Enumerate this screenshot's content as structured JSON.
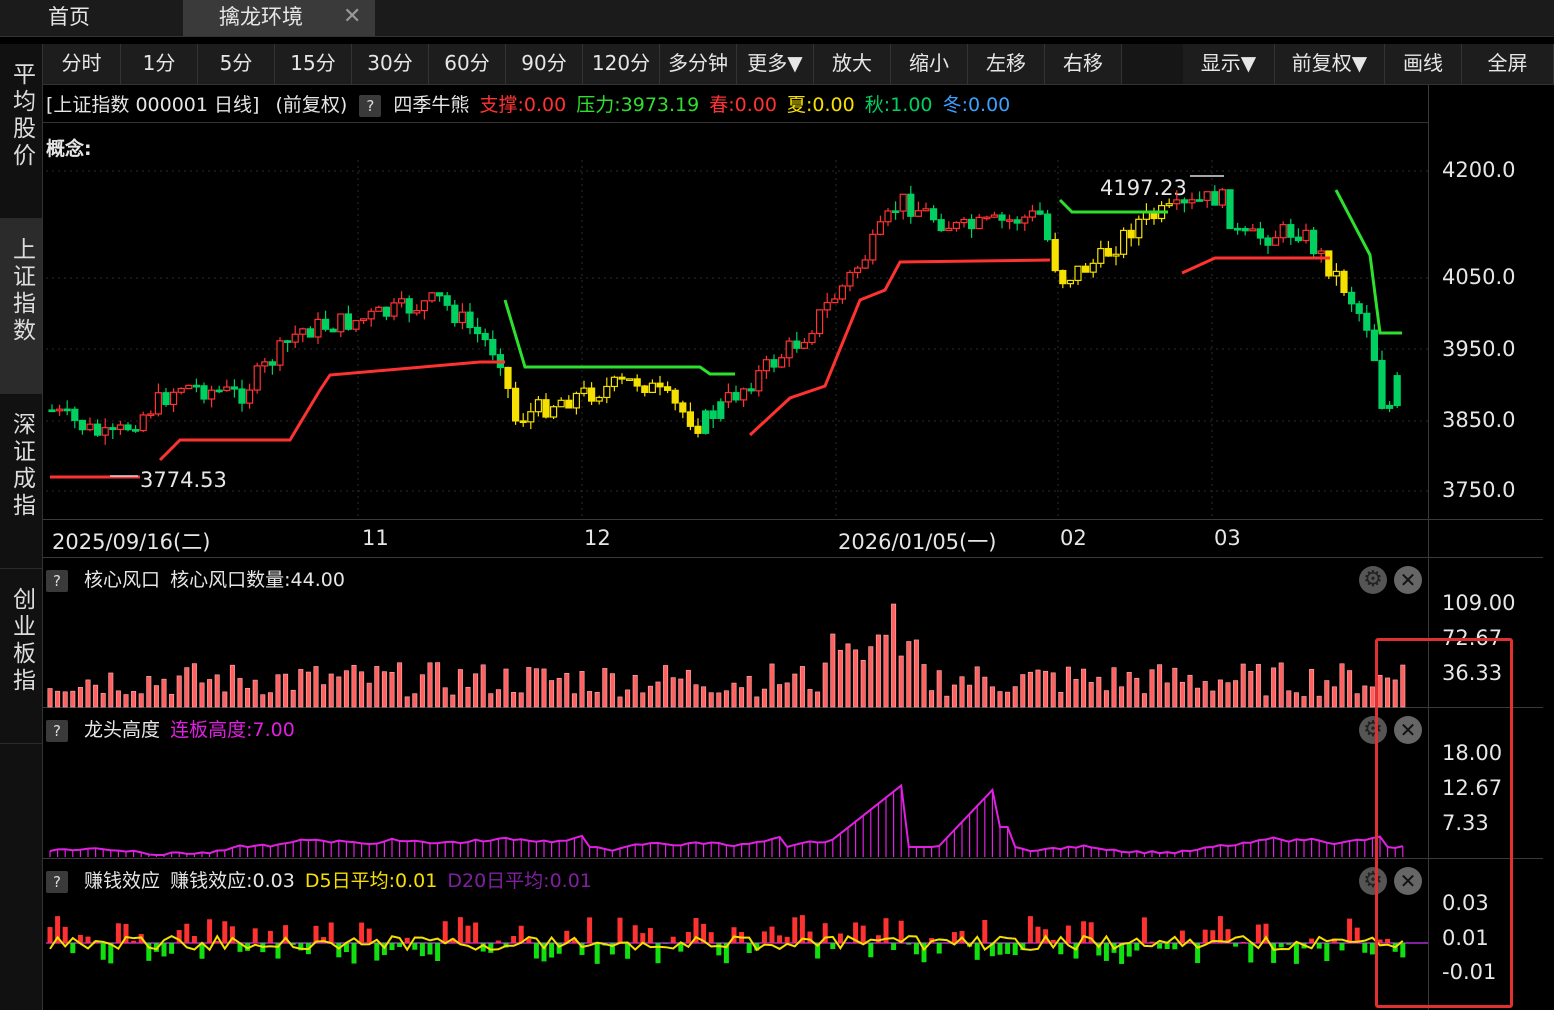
{
  "tabs": {
    "home": "首页",
    "active": "擒龙环境",
    "close_symbol": "✕"
  },
  "left_nav": [
    {
      "label": "平均股价"
    },
    {
      "label": "上证指数"
    },
    {
      "label": "深证成指"
    },
    {
      "label": "创业板指"
    }
  ],
  "toolbar": [
    "分时",
    "1分",
    "5分",
    "15分",
    "30分",
    "60分",
    "90分",
    "120分",
    "多分钟",
    "更多▼",
    "放大",
    "缩小",
    "左移",
    "右移",
    "显示▼",
    "前复权▼",
    "画线",
    "全屏"
  ],
  "price_panel": {
    "title": "[上证指数 000001 日线]",
    "adjust": "(前复权)",
    "indicator": "四季牛熊",
    "support_label": "支撑:0.00",
    "pressure_label": "压力:3973.19",
    "spring_label": "春:0.00",
    "summer_label": "夏:0.00",
    "autumn_label": "秋:1.00",
    "winter_label": "冬:0.00",
    "concept_label": "概念:",
    "high_annotation": "4197.23",
    "low_annotation": "3774.53",
    "y_ticks": [
      "4200.0",
      "4050.0",
      "3950.0",
      "3850.0",
      "3750.0"
    ],
    "x_ticks": [
      "2025/09/16(二)",
      "11",
      "12",
      "2026/01/05(一)",
      "02",
      "03"
    ]
  },
  "panels": [
    {
      "help": "?",
      "name": "核心风口",
      "value_label": "核心风口数量:44.00",
      "y_ticks": [
        "109.00",
        "72.67",
        "36.33"
      ]
    },
    {
      "help": "?",
      "name": "龙头高度",
      "value_label": "连板高度:7.00",
      "y_ticks": [
        "18.00",
        "12.67",
        "7.33"
      ]
    },
    {
      "help": "?",
      "name": "赚钱效应",
      "value_label": "赚钱效应:0.03",
      "d5_label": "D5日平均:0.01",
      "d20_label": "D20日平均:0.01",
      "y_ticks": [
        "0.03",
        "0.01",
        "-0.01"
      ]
    }
  ],
  "colors": {
    "up": "#ff3232",
    "down": "#00d060",
    "yellow": "#f5e000",
    "magenta": "#e020e0",
    "purple": "#8020a0",
    "highlight": "#e03030"
  },
  "icons": {
    "gear": "gear-icon",
    "close": "close-icon"
  }
}
